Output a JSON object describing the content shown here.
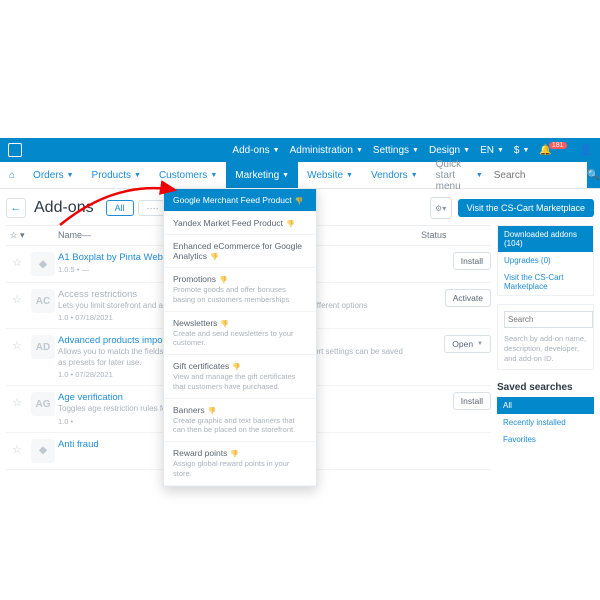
{
  "topbar": {
    "items": [
      "Add-ons",
      "Administration",
      "Settings",
      "Design",
      "EN",
      "$"
    ],
    "notif_count": "181"
  },
  "nav": {
    "home_icon": "⌂",
    "items": [
      "Orders",
      "Products",
      "Customers",
      "Marketing",
      "Website",
      "Vendors"
    ],
    "active_index": 3,
    "quick_start": "Quick start menu",
    "search_placeholder": "Search"
  },
  "page": {
    "title": "Add-ons",
    "filter_all": "All",
    "filter_other": "····",
    "visit_label": "Visit the CS-Cart Marketplace"
  },
  "dropdown": {
    "items": [
      {
        "label": "Google Merchant Feed Product",
        "sub": ""
      },
      {
        "label": "Yandex Market Feed Product",
        "sub": ""
      },
      {
        "label": "Enhanced eCommerce for Google Analytics",
        "sub": ""
      },
      {
        "label": "Promotions",
        "sub": "Promote goods and offer bonuses basing on customers memberships"
      },
      {
        "label": "Newsletters",
        "sub": "Create and send newsletters to your customer."
      },
      {
        "label": "Gift certificates",
        "sub": "View and manage the gift certificates that customers have purchased."
      },
      {
        "label": "Banners",
        "sub": "Create graphic and text banners that can then be placed on the storefront."
      },
      {
        "label": "Reward points",
        "sub": "Assign global reward points in your store."
      }
    ],
    "selected": 0
  },
  "list": {
    "head_name": "Name—",
    "head_status": "Status",
    "rows": [
      {
        "icon": "",
        "title": "A1 Boxplat by Pinta Webware",
        "disabled": false,
        "desc": "",
        "meta": "1.0.5 • —",
        "btn": "Install",
        "caret": false
      },
      {
        "icon": "AC",
        "title": "Access restrictions",
        "disabled": true,
        "desc": "Lets you limit storefront and admin access to certain IP-addresses with different options",
        "meta": "1.0 • 07/18/2021",
        "btn": "Activate",
        "caret": false
      },
      {
        "icon": "AD",
        "title": "Advanced products import",
        "disabled": false,
        "desc": "Allows you to match the fields in the file. These matchings and other import settings can be saved as presets for later use.",
        "meta": "1.0 • 07/28/2021",
        "btn": "Open",
        "caret": true
      },
      {
        "icon": "AG",
        "title": "Age verification",
        "disabled": false,
        "desc": "Toggles age restriction rules for products and categories",
        "meta": "1.0 •",
        "btn": "Install",
        "caret": false
      },
      {
        "icon": "",
        "title": "Anti fraud",
        "disabled": false,
        "desc": "",
        "meta": "",
        "btn": "",
        "caret": false
      }
    ]
  },
  "sidebar": {
    "dl_header": "Downloaded addons (104)",
    "upgrades": "Upgrades (0)",
    "visit": "Visit the CS-Cart Marketplace",
    "search_placeholder": "Search",
    "search_help": "Search by add-on name, description, developer, and add-on ID.",
    "saved_title": "Saved searches",
    "saved": [
      "All",
      "Recently installed",
      "Favorites"
    ]
  }
}
